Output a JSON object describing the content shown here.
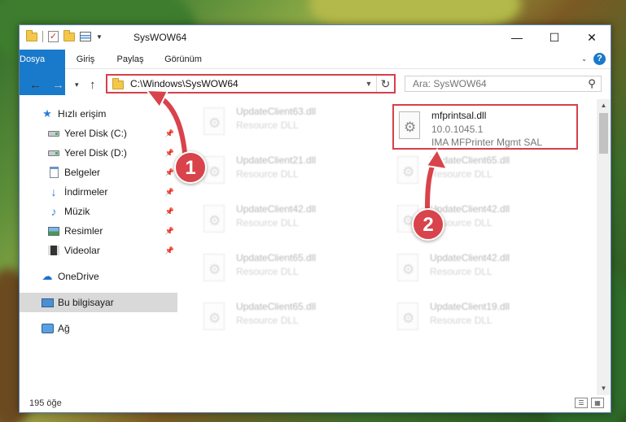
{
  "window": {
    "title": "SysWOW64",
    "controls": {
      "minimize": "—",
      "maximize": "☐",
      "close": "✕"
    }
  },
  "ribbon": {
    "tabs": [
      "Dosya",
      "Giriş",
      "Paylaş",
      "Görünüm"
    ],
    "help": "?"
  },
  "address": {
    "path": "C:\\Windows\\SysWOW64",
    "refresh": "↻"
  },
  "search": {
    "placeholder": "Ara: SysWOW64"
  },
  "nav": {
    "quick_access": "Hızlı erişim",
    "items": [
      "Yerel Disk (C:)",
      "Yerel Disk (D:)",
      "Belgeler",
      "İndirmeler",
      "Müzik",
      "Resimler",
      "Videolar"
    ],
    "onedrive": "OneDrive",
    "this_pc": "Bu bilgisayar",
    "network": "Ağ"
  },
  "files": {
    "highlight": {
      "name": "mfprintsal.dll",
      "version": "10.0.1045.1",
      "company": "IMA MFPrinter Mgmt SAL"
    },
    "left_column": [
      {
        "name": "UpdateClient63.dll",
        "type": "Resource DLL"
      },
      {
        "name": "UpdateClient21.dll",
        "type": "Resource DLL"
      },
      {
        "name": "UpdateClient42.dll",
        "type": "Resource DLL"
      },
      {
        "name": "UpdateClient65.dll",
        "type": "Resource DLL"
      },
      {
        "name": "UpdateClient65.dll",
        "type": "Resource DLL"
      }
    ],
    "right_column": [
      {
        "name": "UpdateClient65.dll",
        "type": "Resource DLL"
      },
      {
        "name": "UpdateClient42.dll",
        "type": "Resource DLL"
      },
      {
        "name": "UpdateClient42.dll",
        "type": "Resource DLL"
      },
      {
        "name": "UpdateClient19.dll",
        "type": "Resource DLL"
      }
    ]
  },
  "status": {
    "count": "195 öğe"
  },
  "callouts": {
    "one": "1",
    "two": "2"
  },
  "colors": {
    "accent": "#1979ca",
    "highlight": "#d8404a"
  }
}
